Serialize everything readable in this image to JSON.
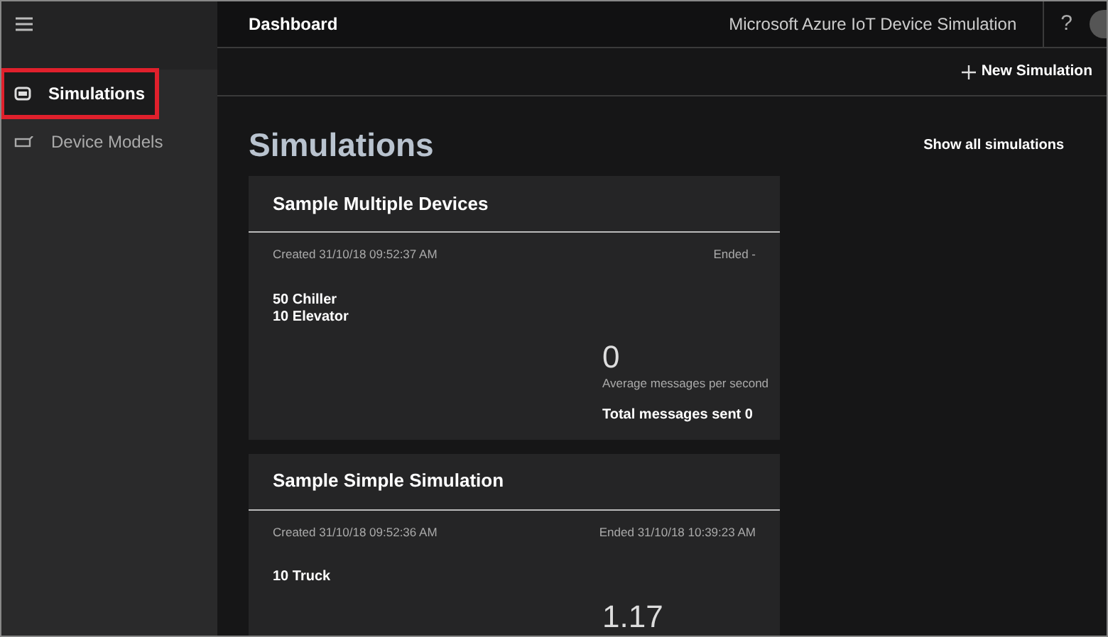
{
  "header": {
    "title": "Dashboard",
    "app_name": "Microsoft Azure IoT Device Simulation",
    "help": "?"
  },
  "sidebar": {
    "items": [
      {
        "label": "Simulations",
        "kind": "simulations",
        "selected": true,
        "highlighted": true
      },
      {
        "label": "Device Models",
        "kind": "models",
        "selected": false,
        "highlighted": false
      }
    ]
  },
  "toolbar": {
    "new_button": "New Simulation"
  },
  "page": {
    "title": "Simulations",
    "show_all": "Show all simulations"
  },
  "simulations": [
    {
      "name": "Sample Multiple Devices",
      "created": "Created 31/10/18 09:52:37 AM",
      "ended": "Ended -",
      "devices": [
        "50 Chiller",
        "10 Elevator"
      ],
      "rate": "0",
      "rate_label": "Average messages per second",
      "total": "Total messages sent 0"
    },
    {
      "name": "Sample Simple Simulation",
      "created": "Created 31/10/18 09:52:36 AM",
      "ended": "Ended 31/10/18 10:39:23 AM",
      "devices": [
        "10 Truck"
      ],
      "rate": "1.17"
    }
  ]
}
